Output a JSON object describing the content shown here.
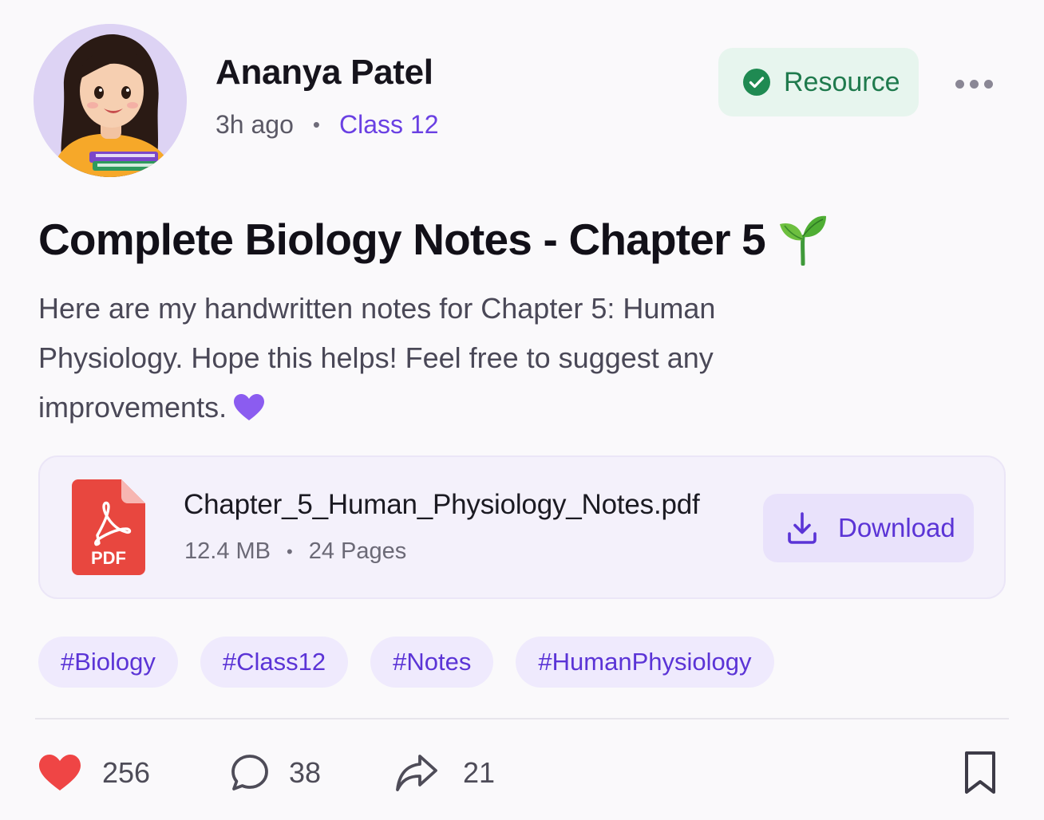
{
  "author": {
    "name": "Ananya Patel",
    "time_ago": "3h ago",
    "class_label": "Class 12"
  },
  "badge": {
    "label": "Resource",
    "icon": "check-circle-icon",
    "color": "#1f7a4d"
  },
  "post": {
    "title": "Complete Biology Notes - Chapter 5",
    "title_emoji": "sprout-icon",
    "body_line1": "Here are my handwritten notes for Chapter 5: Human",
    "body_line2": "Physiology. Hope this helps! Feel free to suggest any",
    "body_line3": "improvements."
  },
  "attachment": {
    "file_name": "Chapter_5_Human_Physiology_Notes.pdf",
    "file_type_label": "PDF",
    "size": "12.4 MB",
    "pages": "24 Pages",
    "download_label": "Download"
  },
  "tags": [
    "#Biology",
    "#Class12",
    "#Notes",
    "#HumanPhysiology"
  ],
  "actions": {
    "likes": "256",
    "comments": "38",
    "shares": "21"
  },
  "colors": {
    "accent": "#6a40e3",
    "like": "#ef4545",
    "pdf": "#e8473f"
  }
}
